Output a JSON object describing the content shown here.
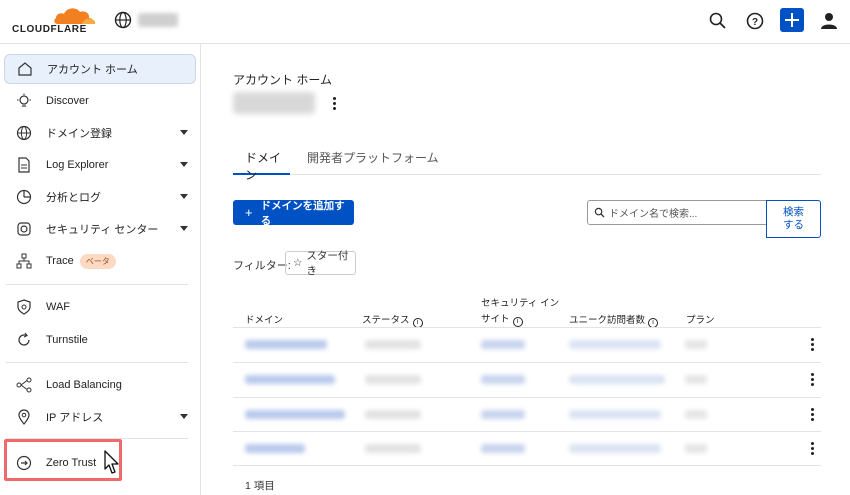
{
  "header": {
    "logo_text": "CLOUDFLARE",
    "icons": [
      "search-icon",
      "help-icon",
      "plus-icon",
      "user-icon"
    ],
    "brand_color": "#f38020",
    "accent_color": "#0051c3"
  },
  "sidebar": {
    "items": [
      {
        "label": "アカウント ホーム",
        "icon": "home-icon",
        "active": true
      },
      {
        "label": "Discover",
        "icon": "lightbulb-icon"
      },
      {
        "label": "ドメイン登録",
        "icon": "globe-icon",
        "caret": true
      },
      {
        "label": "Log Explorer",
        "icon": "document-icon",
        "caret": true
      },
      {
        "label": "分析とログ",
        "icon": "chart-icon",
        "caret": true
      },
      {
        "label": "セキュリティ センター",
        "icon": "gear-icon",
        "caret": true
      },
      {
        "label": "Trace",
        "icon": "trace-icon",
        "badge": "ベータ"
      },
      {
        "label": "WAF",
        "icon": "shield-icon"
      },
      {
        "label": "Turnstile",
        "icon": "refresh-icon"
      },
      {
        "label": "Load Balancing",
        "icon": "share-icon"
      },
      {
        "label": "IP アドレス",
        "icon": "location-icon",
        "caret": true
      },
      {
        "label": "Zero Trust",
        "icon": "zero-trust-icon"
      }
    ]
  },
  "main": {
    "title": "アカウント ホーム",
    "tabs": [
      {
        "label": "ドメイン",
        "active": true
      },
      {
        "label": "開発者プラットフォーム",
        "active": false
      }
    ],
    "add_domain_label": "ドメインを追加する",
    "search": {
      "placeholder": "ドメイン名で検索...",
      "button_label": "検索する"
    },
    "filter_label": "フィルター:",
    "filter_chip": "スター付き",
    "table": {
      "headers": [
        "ドメイン",
        "ステータス",
        "セキュリティ インサイト",
        "ユニーク訪問者数",
        "プラン"
      ],
      "row_count": 4
    },
    "footer_count": "1 項目"
  }
}
